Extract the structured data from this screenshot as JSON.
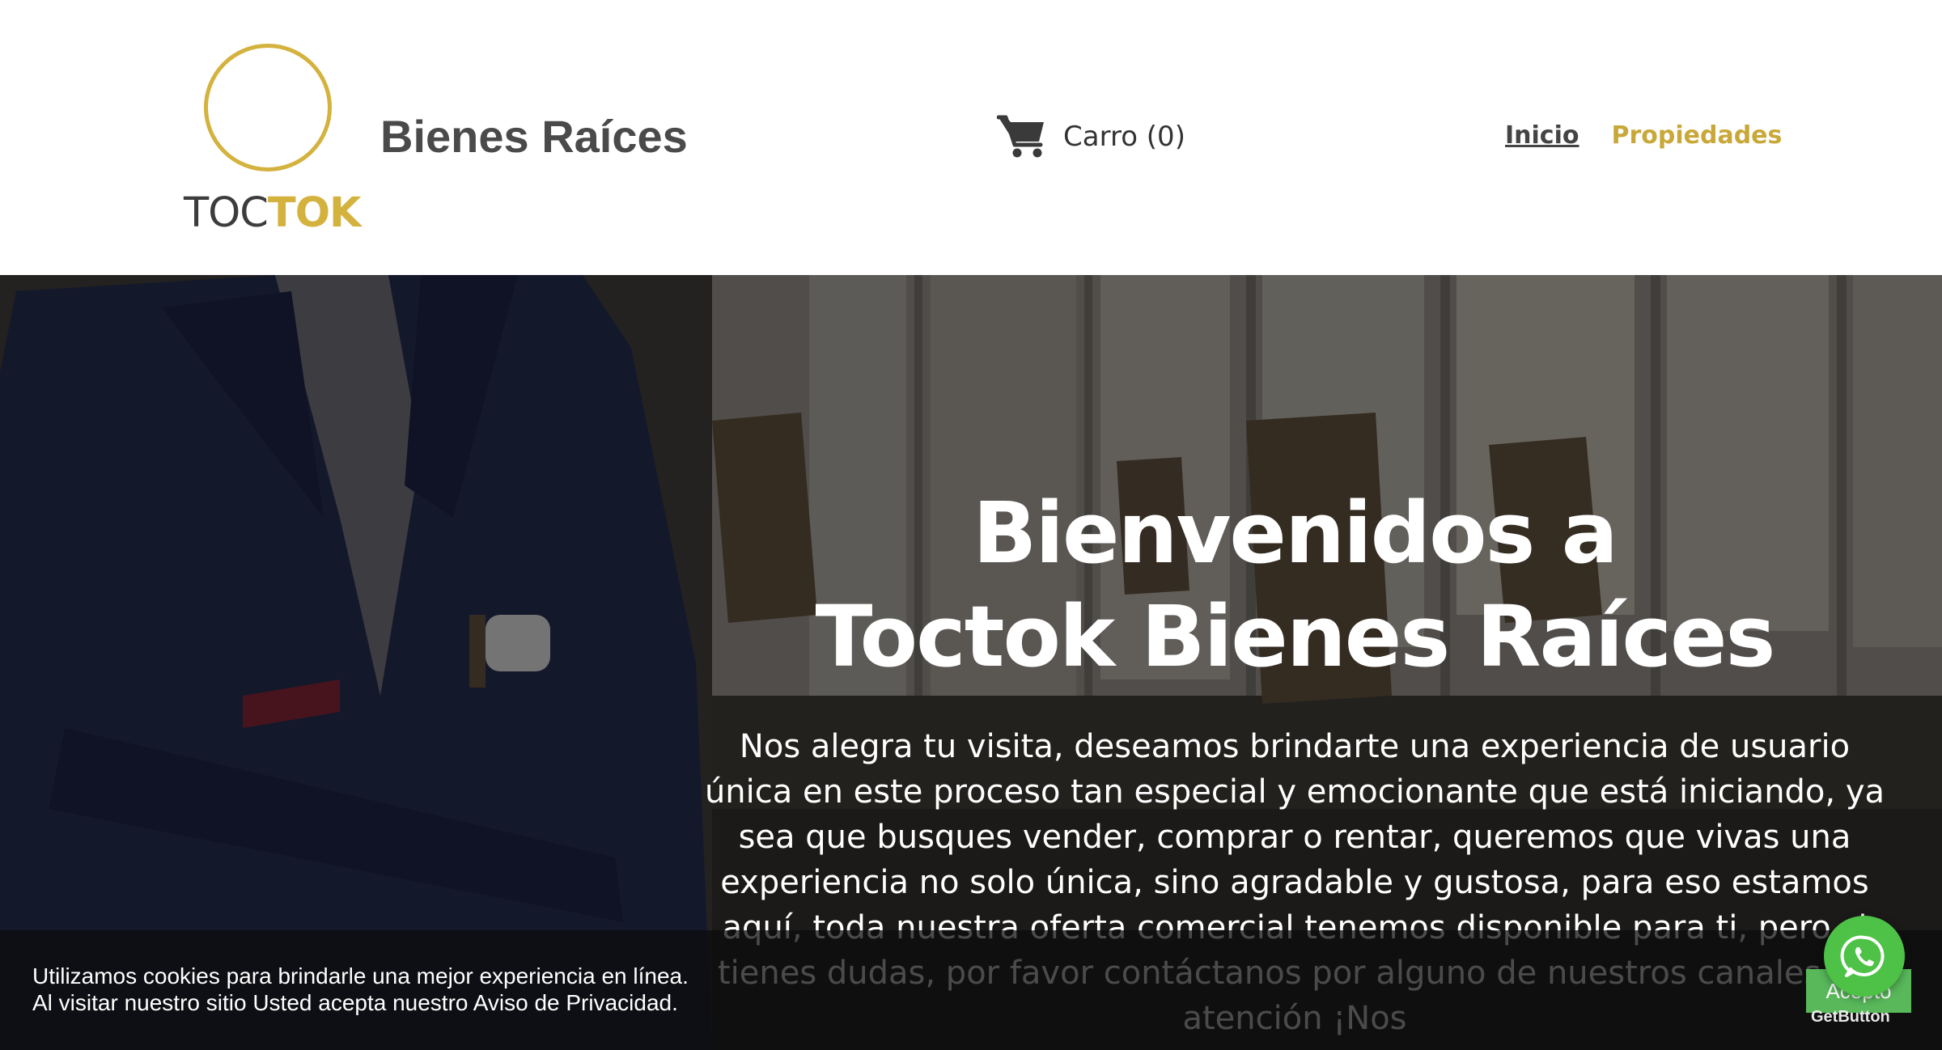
{
  "header": {
    "logo": {
      "word_dark": "TOC",
      "word_gold": "TOK"
    },
    "brand_title": "Bienes Raíces",
    "cart": {
      "icon": "shopping-cart-icon",
      "label": "Carro (0)"
    },
    "nav": [
      {
        "label": "Inicio",
        "active": true
      },
      {
        "label": "Propiedades",
        "active": false
      }
    ]
  },
  "hero": {
    "title_line1": "Bienvenidos a",
    "title_line2": "Toctok Bienes Raíces",
    "text": "Nos alegra tu visita, deseamos brindarte una experiencia de usuario única en este proceso tan especial y emocionante que está iniciando, ya sea que busques vender, comprar o rentar, queremos que vivas una experiencia no solo única, sino agradable y gustosa, para eso estamos aquí, toda nuestra oferta comercial tenemos disponible para ti, pero si tienes dudas, por favor contáctanos por alguno de nuestros canales de atención ¡Nos"
  },
  "cookie_banner": {
    "line1": "Utilizamos cookies para brindarle una mejor experiencia en línea.",
    "line2": "Al visitar nuestro sitio Usted acepta nuestro Aviso de Privacidad.",
    "accept_label": "Acepto"
  },
  "whatsapp": {
    "icon": "whatsapp-icon",
    "credit": "GetButton"
  },
  "colors": {
    "gold": "#d4b23e",
    "dark_text": "#4a4a4a",
    "whatsapp_green": "#4dc247",
    "accept_green": "#58b85a"
  }
}
